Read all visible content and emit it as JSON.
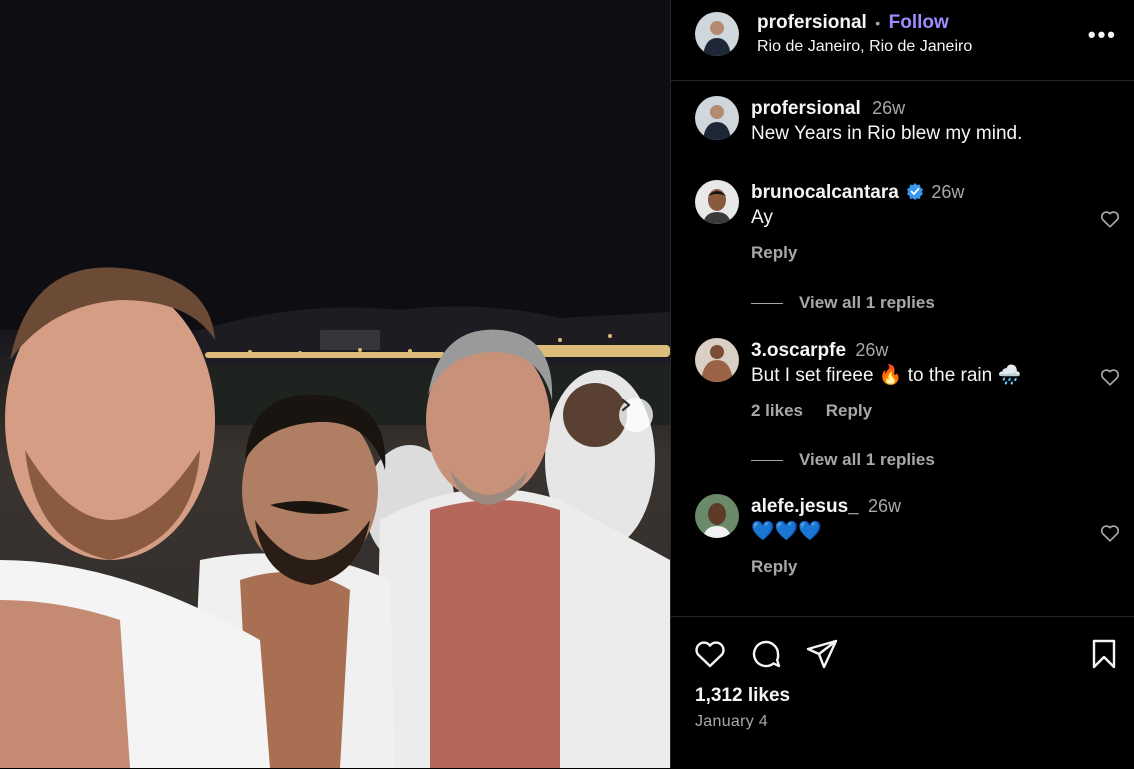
{
  "post": {
    "author": "profersional",
    "separator": "•",
    "follow_label": "Follow",
    "location": "Rio de Janeiro, Rio de Janeiro",
    "more_label": "•••"
  },
  "caption": {
    "username": "profersional",
    "time": "26w",
    "text": "New Years in Rio blew my mind."
  },
  "comments": [
    {
      "username": "brunocalcantara",
      "verified": true,
      "time": "26w",
      "text": "Ay",
      "likes": "",
      "reply_label": "Reply",
      "view_replies": "View all 1 replies"
    },
    {
      "username": "3.oscarpfe",
      "verified": false,
      "time": "26w",
      "text": "But I set fireee 🔥 to the rain 🌧️",
      "likes": "2 likes",
      "reply_label": "Reply",
      "view_replies": "View all 1 replies"
    },
    {
      "username": "alefe.jesus_",
      "verified": false,
      "time": "26w",
      "text": "💙💙💙",
      "likes": "",
      "reply_label": "Reply",
      "view_replies": ""
    }
  ],
  "footer": {
    "likes": "1,312 likes",
    "date": "January 4"
  },
  "icons": {
    "next": "chevron-right-icon",
    "like": "heart-icon",
    "comment": "comment-bubble-icon",
    "share": "paper-plane-icon",
    "save": "bookmark-icon",
    "verified": "verified-badge-icon"
  },
  "colors": {
    "background": "#000000",
    "accent_follow": "#9b8cff",
    "verified": "#3897f0",
    "muted_text": "#a8a8a8",
    "divider": "#262626"
  }
}
